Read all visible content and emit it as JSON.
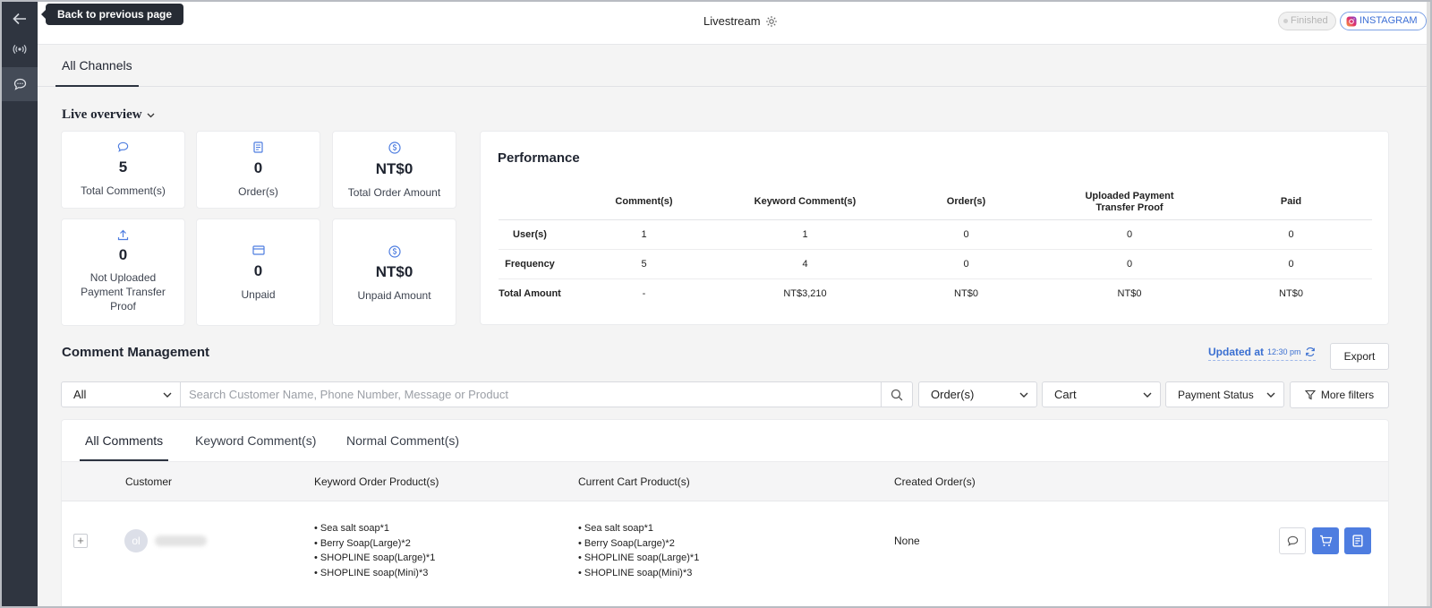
{
  "header": {
    "title": "Livestream",
    "status_badge": "Finished",
    "platform_badge": "INSTAGRAM"
  },
  "tooltip": {
    "back": "Back to previous page"
  },
  "channel_tabs": [
    "All Channels"
  ],
  "overview": {
    "title": "Live overview",
    "stats": [
      {
        "value": "5",
        "label": "Total Comment(s)",
        "icon": "comment-icon"
      },
      {
        "value": "0",
        "label": "Order(s)",
        "icon": "receipt-icon"
      },
      {
        "value": "NT$0",
        "label": "Total Order Amount",
        "icon": "dollar-icon"
      },
      {
        "value": "0",
        "label": "Not Uploaded Payment Transfer Proof",
        "icon": "upload-icon"
      },
      {
        "value": "0",
        "label": "Unpaid",
        "icon": "card-icon"
      },
      {
        "value": "NT$0",
        "label": "Unpaid Amount",
        "icon": "dollar-icon"
      }
    ]
  },
  "performance": {
    "title": "Performance",
    "columns": [
      "",
      "Comment(s)",
      "Keyword Comment(s)",
      "Order(s)",
      "Uploaded Payment Transfer Proof",
      "Paid"
    ],
    "rows": [
      {
        "label": "User(s)",
        "values": [
          "1",
          "1",
          "0",
          "0",
          "0"
        ]
      },
      {
        "label": "Frequency",
        "values": [
          "5",
          "4",
          "0",
          "0",
          "0"
        ]
      },
      {
        "label": "Total Amount",
        "values": [
          "-",
          "NT$3,210",
          "NT$0",
          "NT$0",
          "NT$0"
        ]
      }
    ]
  },
  "comment_management": {
    "title": "Comment Management",
    "updated_label": "Updated at",
    "updated_time": "12:30 pm",
    "export_label": "Export",
    "filters": {
      "channel_select": "All",
      "search_placeholder": "Search Customer Name, Phone Number, Message or Product",
      "orders_select": "Order(s)",
      "cart_select": "Cart",
      "payment_select": "Payment Status",
      "more_filters": "More filters"
    },
    "tabs": [
      "All Comments",
      "Keyword Comment(s)",
      "Normal Comment(s)"
    ],
    "table_headers": [
      "Customer",
      "Keyword Order Product(s)",
      "Current Cart Product(s)",
      "Created Order(s)"
    ],
    "rows": [
      {
        "avatar_initials": "ol",
        "keyword_products": [
          "Sea salt soap*1",
          "Berry Soap(Large)*2",
          "SHOPLINE soap(Large)*1",
          "SHOPLINE soap(Mini)*3"
        ],
        "cart_products": [
          "Sea salt soap*1",
          "Berry Soap(Large)*2",
          "SHOPLINE soap(Large)*1",
          "SHOPLINE soap(Mini)*3"
        ],
        "created_orders": "None"
      }
    ]
  },
  "colors": {
    "rail": "#2f3540",
    "accent": "#4e7de0",
    "link": "#3a6fd1"
  }
}
